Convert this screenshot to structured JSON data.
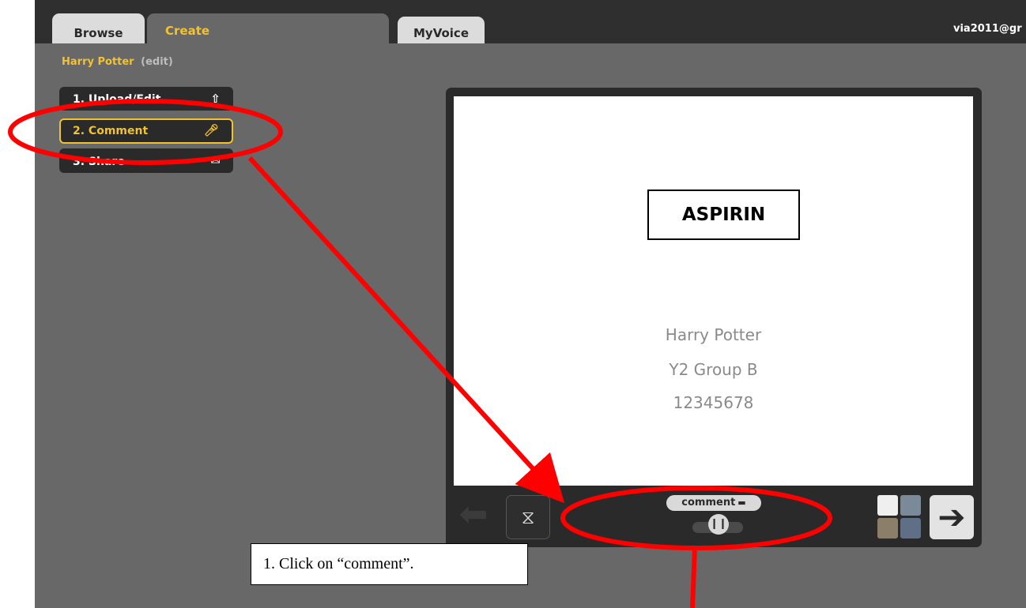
{
  "tabs": {
    "browse": "Browse",
    "create": "Create",
    "myvoice": "MyVoice"
  },
  "user": {
    "email": "via2011@gr"
  },
  "project": {
    "title": "Harry Potter",
    "edit": "(edit)"
  },
  "steps": [
    {
      "label": "1. Upload/Edit",
      "icon": "upload-icon"
    },
    {
      "label": "2. Comment",
      "icon": "microphone-icon"
    },
    {
      "label": "3. Share",
      "icon": "share-icon"
    }
  ],
  "slide": {
    "heading": "ASPIRIN",
    "lines": [
      "Harry Potter",
      "Y2 Group B",
      "12345678"
    ]
  },
  "controls": {
    "comment_label": "comment"
  },
  "annotation": {
    "callout": "1. Click on “comment”."
  },
  "colors": {
    "accent": "#f2c230",
    "annotation": "#ff0000",
    "panel": "#686868",
    "dark": "#2a2a2a"
  }
}
